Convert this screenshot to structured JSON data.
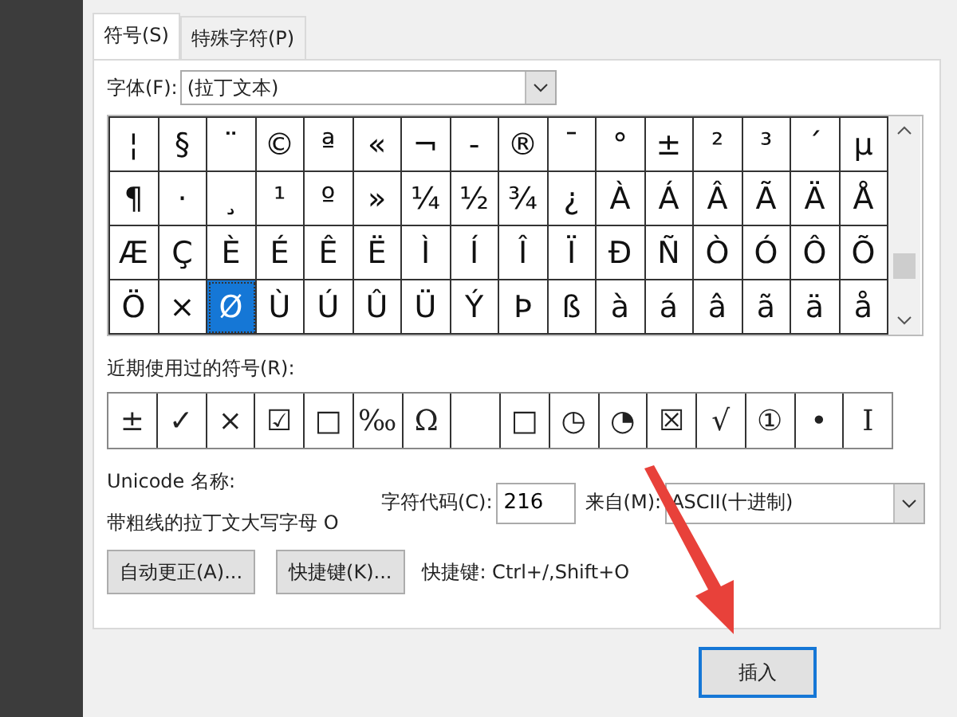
{
  "tabs": [
    {
      "label": "符号(S)",
      "selected": true
    },
    {
      "label": "特殊字符(P)",
      "selected": false
    }
  ],
  "font": {
    "label": "字体(F):",
    "value": "(拉丁文本)"
  },
  "symbols": [
    {
      "char": "¦",
      "selected": false
    },
    {
      "char": "§",
      "selected": false
    },
    {
      "char": "¨",
      "selected": false
    },
    {
      "char": "©",
      "selected": false
    },
    {
      "char": "ª",
      "selected": false
    },
    {
      "char": "«",
      "selected": false
    },
    {
      "char": "¬",
      "selected": false
    },
    {
      "char": "-",
      "selected": false
    },
    {
      "char": "®",
      "selected": false
    },
    {
      "char": "¯",
      "selected": false
    },
    {
      "char": "°",
      "selected": false
    },
    {
      "char": "±",
      "selected": false
    },
    {
      "char": "²",
      "selected": false
    },
    {
      "char": "³",
      "selected": false
    },
    {
      "char": "´",
      "selected": false
    },
    {
      "char": "µ",
      "selected": false
    },
    {
      "char": "¶",
      "selected": false
    },
    {
      "char": "·",
      "selected": false
    },
    {
      "char": "¸",
      "selected": false
    },
    {
      "char": "¹",
      "selected": false
    },
    {
      "char": "º",
      "selected": false
    },
    {
      "char": "»",
      "selected": false
    },
    {
      "char": "¼",
      "selected": false
    },
    {
      "char": "½",
      "selected": false
    },
    {
      "char": "¾",
      "selected": false
    },
    {
      "char": "¿",
      "selected": false
    },
    {
      "char": "À",
      "selected": false
    },
    {
      "char": "Á",
      "selected": false
    },
    {
      "char": "Â",
      "selected": false
    },
    {
      "char": "Ã",
      "selected": false
    },
    {
      "char": "Ä",
      "selected": false
    },
    {
      "char": "Å",
      "selected": false
    },
    {
      "char": "Æ",
      "selected": false
    },
    {
      "char": "Ç",
      "selected": false
    },
    {
      "char": "È",
      "selected": false
    },
    {
      "char": "É",
      "selected": false
    },
    {
      "char": "Ê",
      "selected": false
    },
    {
      "char": "Ë",
      "selected": false
    },
    {
      "char": "Ì",
      "selected": false
    },
    {
      "char": "Í",
      "selected": false
    },
    {
      "char": "Î",
      "selected": false
    },
    {
      "char": "Ï",
      "selected": false
    },
    {
      "char": "Ð",
      "selected": false
    },
    {
      "char": "Ñ",
      "selected": false
    },
    {
      "char": "Ò",
      "selected": false
    },
    {
      "char": "Ó",
      "selected": false
    },
    {
      "char": "Ô",
      "selected": false
    },
    {
      "char": "Õ",
      "selected": false
    },
    {
      "char": "Ö",
      "selected": false
    },
    {
      "char": "×",
      "selected": false
    },
    {
      "char": "Ø",
      "selected": true
    },
    {
      "char": "Ù",
      "selected": false
    },
    {
      "char": "Ú",
      "selected": false
    },
    {
      "char": "Û",
      "selected": false
    },
    {
      "char": "Ü",
      "selected": false
    },
    {
      "char": "Ý",
      "selected": false
    },
    {
      "char": "Þ",
      "selected": false
    },
    {
      "char": "ß",
      "selected": false
    },
    {
      "char": "à",
      "selected": false
    },
    {
      "char": "á",
      "selected": false
    },
    {
      "char": "â",
      "selected": false
    },
    {
      "char": "ã",
      "selected": false
    },
    {
      "char": "ä",
      "selected": false
    },
    {
      "char": "å",
      "selected": false
    }
  ],
  "recent_label": "近期使用过的符号(R):",
  "recent": [
    {
      "kind": "symbol",
      "char": "±"
    },
    {
      "kind": "symbol",
      "char": "✓"
    },
    {
      "kind": "symbol",
      "char": "×"
    },
    {
      "kind": "symbol",
      "char": "☑"
    },
    {
      "kind": "symbol",
      "char": "□"
    },
    {
      "kind": "symbol",
      "char": "‰"
    },
    {
      "kind": "symbol",
      "char": "Ω"
    },
    {
      "kind": "blank"
    },
    {
      "kind": "symbol",
      "char": "□"
    },
    {
      "kind": "symbol",
      "char": "◷"
    },
    {
      "kind": "symbol",
      "char": "◔"
    },
    {
      "kind": "symbol",
      "char": "☒"
    },
    {
      "kind": "symbol",
      "char": "√"
    },
    {
      "kind": "symbol",
      "char": "①"
    },
    {
      "kind": "symbol",
      "char": "•"
    },
    {
      "kind": "symbol",
      "char": "I"
    }
  ],
  "unicode_label": "Unicode 名称:",
  "unicode_name": "带粗线的拉丁文大写字母 O",
  "code": {
    "label": "字符代码(C):",
    "value": "216"
  },
  "from": {
    "label": "来自(M):",
    "value": "ASCII(十进制)"
  },
  "buttons": [
    {
      "label": "自动更正(A)..."
    },
    {
      "label": "快捷键(K)..."
    }
  ],
  "shortcut": "快捷键: Ctrl+/,Shift+O",
  "insert_button": "插入"
}
